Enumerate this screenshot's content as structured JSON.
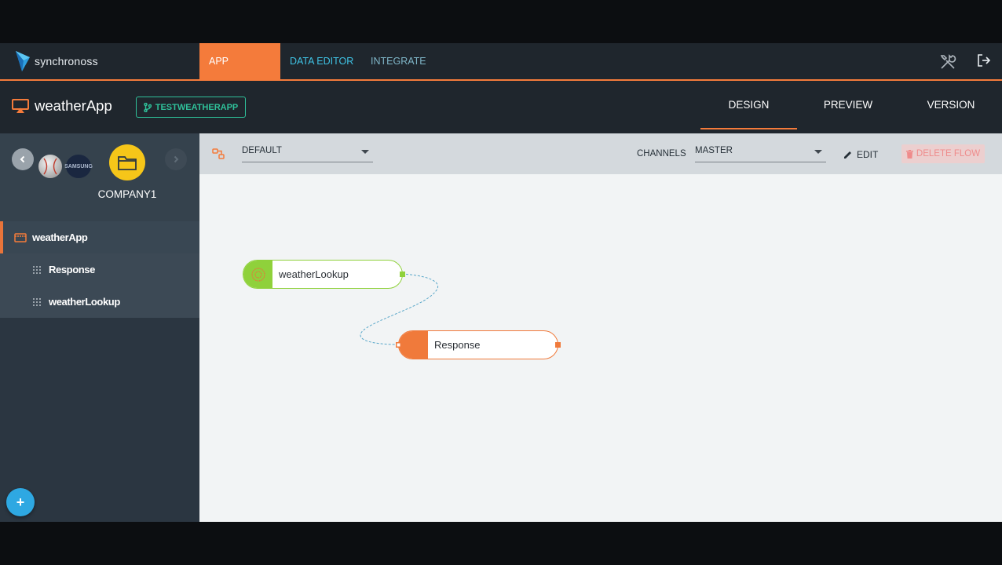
{
  "brand": {
    "name": "synchronoss"
  },
  "topnav": {
    "tabs": [
      {
        "label": "APP BUILDER",
        "active": true
      },
      {
        "label": "DATA EDITOR",
        "active": false
      },
      {
        "label": "INTEGRATE",
        "active": false
      }
    ]
  },
  "app": {
    "title": "weatherApp",
    "branch": "TESTWEATHERAPP",
    "view_tabs": [
      {
        "label": "DESIGN",
        "active": true
      },
      {
        "label": "PREVIEW",
        "active": false
      },
      {
        "label": "VERSION",
        "active": false
      }
    ]
  },
  "sidebar": {
    "company": "COMPANY1",
    "samsung_label": "SAMSUNG",
    "tree": [
      {
        "label": "weatherApp",
        "level": 0
      },
      {
        "label": "Response",
        "level": 1
      },
      {
        "label": "weatherLookup",
        "level": 1
      }
    ],
    "add_label": "+"
  },
  "toolbar": {
    "flow_select": "DEFAULT",
    "channels_label": "CHANNELS",
    "channel_select": "MASTER",
    "edit_label": "EDIT",
    "delete_label": "DELETE FLOW"
  },
  "flow": {
    "nodes": [
      {
        "label": "weatherLookup",
        "color": "#8fd13b"
      },
      {
        "label": "Response",
        "color": "#f07a3b"
      }
    ]
  },
  "colors": {
    "accent": "#f47b3b",
    "link": "#3fc4e6",
    "branch": "#2fc19a",
    "company": "#f6c619"
  }
}
